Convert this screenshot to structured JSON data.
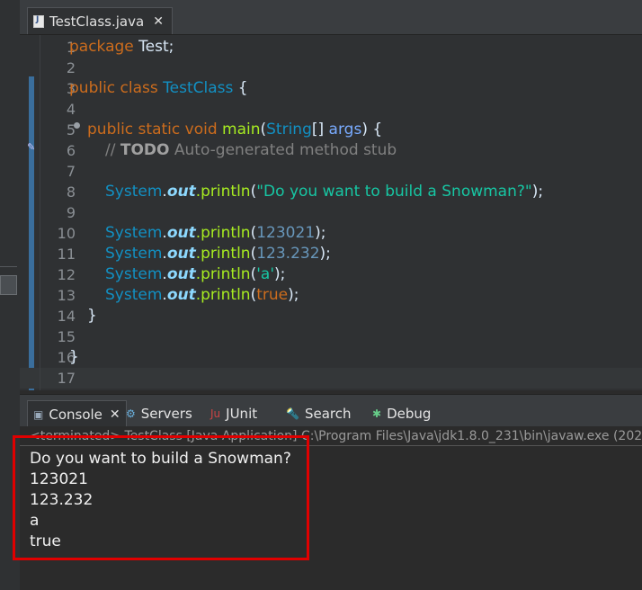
{
  "editor": {
    "tab_label": "TestClass.java",
    "tab_close": "✕",
    "lines": [
      {
        "n": "1"
      },
      {
        "n": "2"
      },
      {
        "n": "3"
      },
      {
        "n": "4"
      },
      {
        "n": "5"
      },
      {
        "n": "6"
      },
      {
        "n": "7"
      },
      {
        "n": "8"
      },
      {
        "n": "9"
      },
      {
        "n": "10"
      },
      {
        "n": "11"
      },
      {
        "n": "12"
      },
      {
        "n": "13"
      },
      {
        "n": "14"
      },
      {
        "n": "15"
      },
      {
        "n": "16"
      },
      {
        "n": "17"
      }
    ],
    "code": {
      "l1_kw": "package",
      "l1_rest": " Test;",
      "l3_kw": "public class",
      "l3_type": " TestClass",
      "l3_rest": " {",
      "l5_kw": "public static void",
      "l5_meth": " main",
      "l5_p1": "(",
      "l5_type": "String",
      "l5_p2": "[] ",
      "l5_arg": "args",
      "l5_p3": ") {",
      "l6_cmt1": "// ",
      "l6_todo": "TODO",
      "l6_cmt2": " Auto-generated method stub",
      "sys": "System",
      "dot": ".",
      "out": "out",
      "println": ".println",
      "l8_p1": "(",
      "l8_str": "\"Do you want to build a Snowman?\"",
      "l8_p2": ");",
      "l10_num": "123021",
      "l11_num": "123.232",
      "l12_str": "'a'",
      "l13_kw": "true",
      "close_paren": ");",
      "open_paren": "(",
      "l14": "}",
      "l16": "}"
    }
  },
  "console": {
    "tabs": [
      {
        "label": "Console",
        "icon": "console-icon"
      },
      {
        "label": "Servers",
        "icon": "servers-icon"
      },
      {
        "label": "JUnit",
        "icon": "junit-icon"
      },
      {
        "label": "Search",
        "icon": "search-icon"
      },
      {
        "label": "Debug",
        "icon": "debug-icon"
      }
    ],
    "close": "✕",
    "status": "<terminated> TestClass [Java Application] C:\\Program Files\\Java\\jdk1.8.0_231\\bin\\javaw.exe (202",
    "output": [
      "Do you want to build a Snowman?",
      "123021",
      "123.232",
      "a",
      "true"
    ]
  },
  "colors": {
    "highlight": "#e00000",
    "keyword": "#cc6c1d",
    "type": "#1290c3",
    "method": "#a7ec21",
    "string": "#17c6a3"
  }
}
